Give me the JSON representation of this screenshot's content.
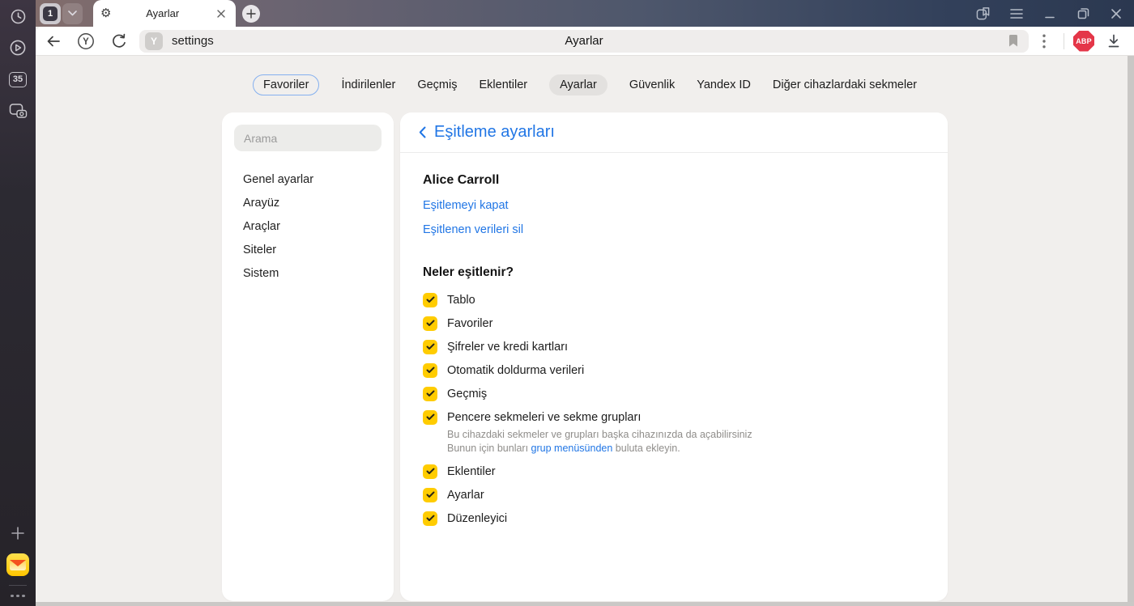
{
  "colors": {
    "accent": "#2176e5",
    "checkbox_yellow": "#ffcc00",
    "abp_red": "#e43648"
  },
  "rail": {
    "counter_badge": "35"
  },
  "tab_bar": {
    "tab_counter": "1",
    "active_tab_title": "Ayarlar"
  },
  "toolbar": {
    "url_text": "settings",
    "page_title": "Ayarlar",
    "favicon_letter": "Y",
    "yandex_button_letter": "Y",
    "abp_label": "ABP"
  },
  "nav": {
    "tabs": [
      {
        "label": "Favoriler"
      },
      {
        "label": "İndirilenler"
      },
      {
        "label": "Geçmiş"
      },
      {
        "label": "Eklentiler"
      },
      {
        "label": "Ayarlar"
      },
      {
        "label": "Güvenlik"
      },
      {
        "label": "Yandex ID"
      },
      {
        "label": "Diğer cihazlardaki sekmeler"
      }
    ]
  },
  "sidebar": {
    "search_placeholder": "Arama",
    "items": [
      {
        "label": "Genel ayarlar"
      },
      {
        "label": "Arayüz"
      },
      {
        "label": "Araçlar"
      },
      {
        "label": "Siteler"
      },
      {
        "label": "Sistem"
      }
    ]
  },
  "content": {
    "title": "Eşitleme ayarları",
    "account_name": "Alice Carroll",
    "link_disable_sync": "Eşitlemeyi kapat",
    "link_delete_synced": "Eşitlenen verileri sil",
    "section_title": "Neler eşitlenir?",
    "sync_items": [
      {
        "label": "Tablo",
        "checked": true
      },
      {
        "label": "Favoriler",
        "checked": true
      },
      {
        "label": "Şifreler ve kredi kartları",
        "checked": true
      },
      {
        "label": "Otomatik doldurma verileri",
        "checked": true
      },
      {
        "label": "Geçmiş",
        "checked": true
      },
      {
        "label": "Pencere sekmeleri ve sekme grupları",
        "checked": true,
        "desc_line1": "Bu cihazdaki sekmeler ve grupları başka cihazınızda da açabilirsiniz",
        "desc_line2_prefix": "Bunun için bunları ",
        "desc_link": "grup menüsünden",
        "desc_line2_suffix": " buluta ekleyin."
      },
      {
        "label": "Eklentiler",
        "checked": true
      },
      {
        "label": "Ayarlar",
        "checked": true
      },
      {
        "label": "Düzenleyici",
        "checked": true
      }
    ]
  }
}
